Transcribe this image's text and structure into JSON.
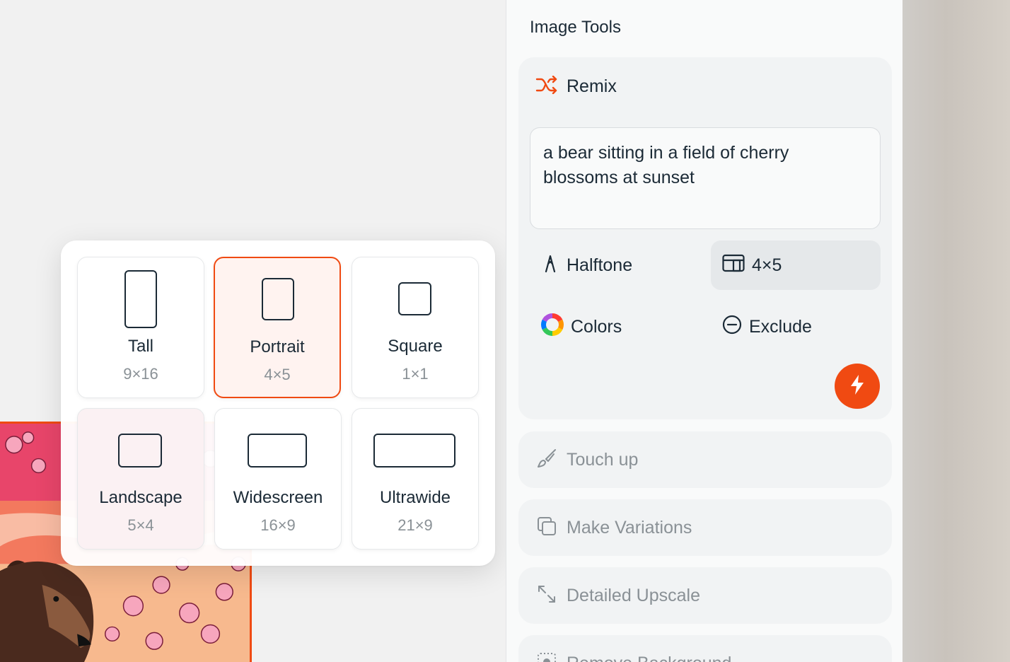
{
  "sidebar": {
    "title": "Image Tools",
    "remix": {
      "label": "Remix",
      "prompt": "a bear sitting in a field of cherry blossoms at sunset",
      "options": {
        "halftone": "Halftone",
        "aspect": "4×5",
        "colors": "Colors",
        "exclude": "Exclude"
      }
    },
    "tools": [
      {
        "label": "Touch up",
        "icon": "brush-icon"
      },
      {
        "label": "Make Variations",
        "icon": "variations-icon"
      },
      {
        "label": "Detailed Upscale",
        "icon": "expand-icon"
      },
      {
        "label": "Remove Background",
        "icon": "remove-background-icon"
      }
    ]
  },
  "aspect_popup": {
    "selected": "Portrait",
    "options": [
      {
        "name": "Tall",
        "ratio": "9×16"
      },
      {
        "name": "Portrait",
        "ratio": "4×5"
      },
      {
        "name": "Square",
        "ratio": "1×1"
      },
      {
        "name": "Landscape",
        "ratio": "5×4"
      },
      {
        "name": "Widescreen",
        "ratio": "16×9"
      },
      {
        "name": "Ultrawide",
        "ratio": "21×9"
      }
    ]
  },
  "colors": {
    "accent": "#f04a12",
    "text": "#1b2a36",
    "muted": "#8a9196"
  }
}
